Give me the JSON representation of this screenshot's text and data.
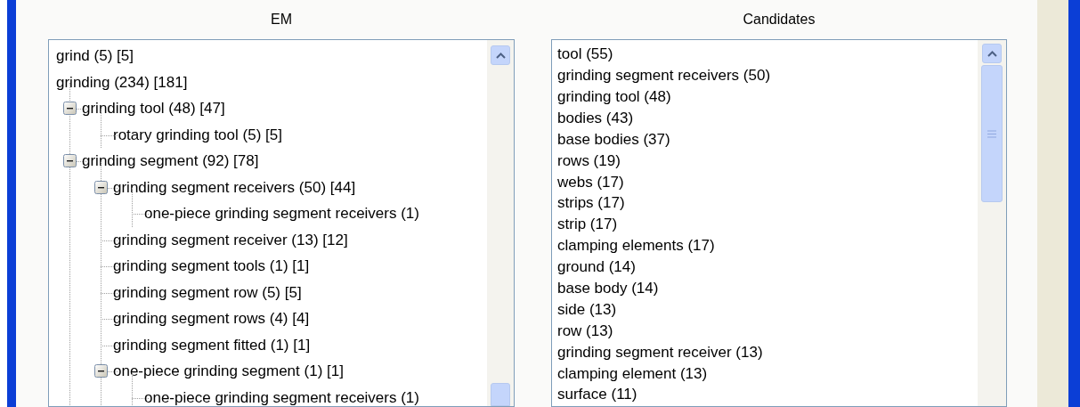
{
  "em": {
    "heading": "EM",
    "tree": [
      {
        "label": "grind (5) [5]"
      },
      {
        "label": "grinding (234) [181]",
        "children": [
          {
            "label": "grinding tool (48) [47]",
            "expanded": true,
            "children": [
              {
                "label": "rotary grinding tool (5) [5]"
              }
            ]
          },
          {
            "label": "grinding segment (92) [78]",
            "expanded": true,
            "children": [
              {
                "label": "grinding segment receivers (50) [44]",
                "expanded": true,
                "children": [
                  {
                    "label": "one-piece grinding segment receivers (1)"
                  }
                ]
              },
              {
                "label": "grinding segment receiver (13) [12]"
              },
              {
                "label": "grinding segment tools (1) [1]"
              },
              {
                "label": "grinding segment row (5) [5]"
              },
              {
                "label": "grinding segment rows (4) [4]"
              },
              {
                "label": "grinding segment fitted (1) [1]"
              },
              {
                "label": "one-piece grinding segment (1) [1]",
                "expanded": true,
                "children": [
                  {
                    "label": "one-piece grinding segment receivers (1)"
                  }
                ]
              }
            ]
          }
        ]
      }
    ]
  },
  "candidates": {
    "heading": "Candidates",
    "items": [
      "tool (55)",
      "grinding segment receivers (50)",
      "grinding tool (48)",
      "bodies (43)",
      "base bodies (37)",
      "rows (19)",
      "webs (17)",
      "strips (17)",
      "strip (17)",
      "clamping elements (17)",
      "ground (14)",
      "base body (14)",
      "side (13)",
      "row (13)",
      "grinding segment receiver (13)",
      "clamping element (13)",
      "surface (11)"
    ]
  }
}
